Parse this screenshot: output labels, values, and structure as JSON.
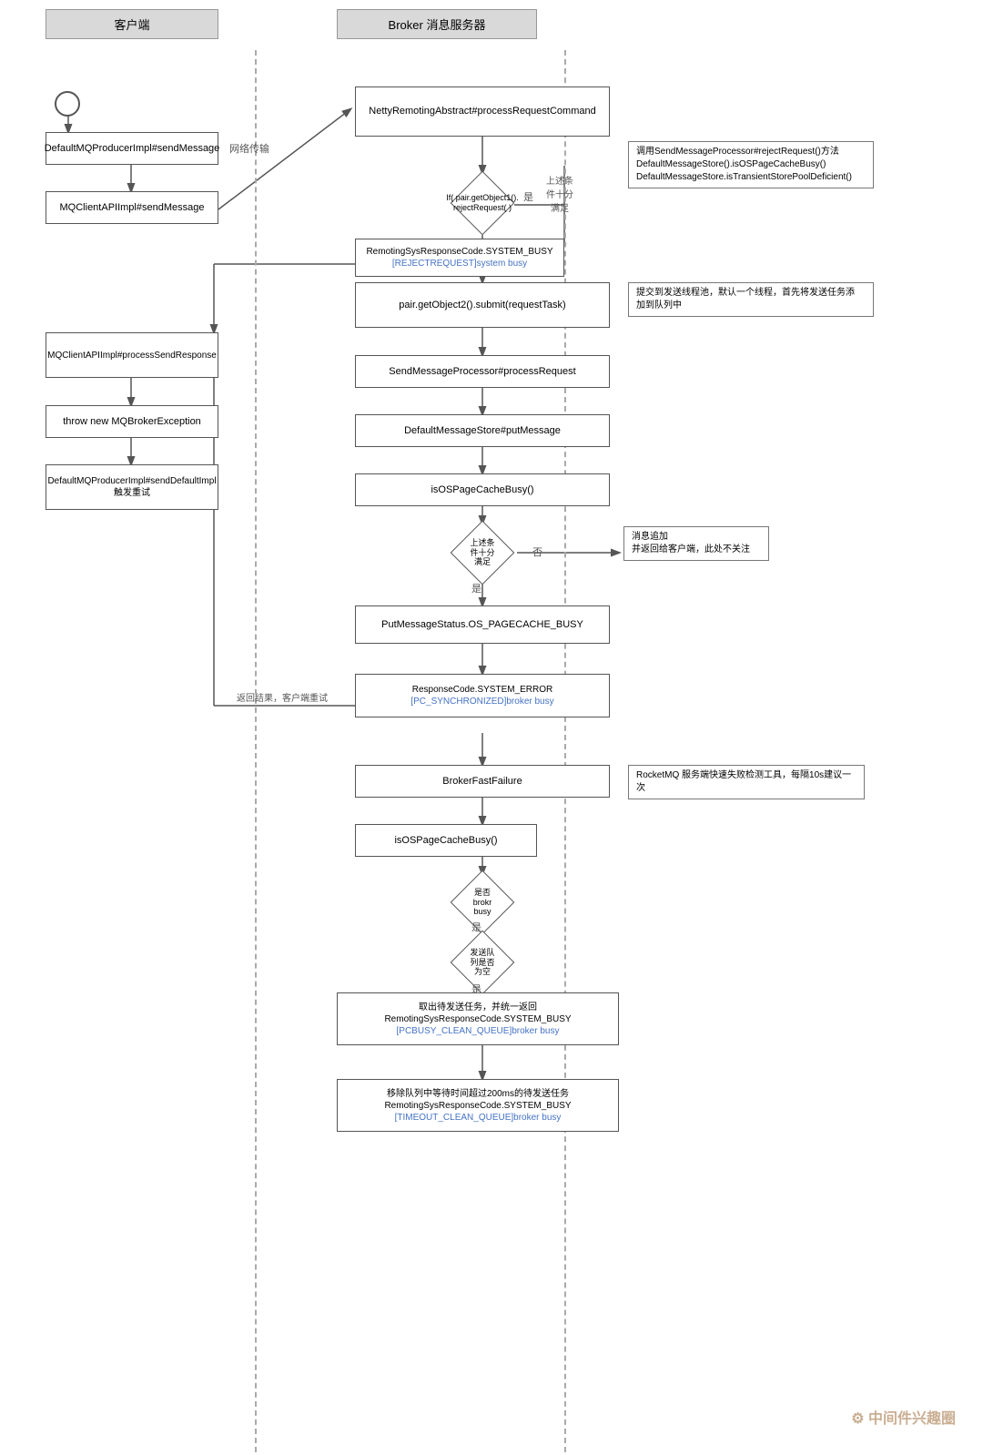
{
  "headers": {
    "client": "客户端",
    "broker": "Broker 消息服务器"
  },
  "nodes": {
    "start": {
      "label": ""
    },
    "n1": {
      "label": "DefaultMQProducerImpl#sendMessage"
    },
    "n2": {
      "label": "MQClientAPIImpl#sendMessage"
    },
    "n3": {
      "label": "NettyRemotingAbstract#processRequestCommand"
    },
    "n4_condition": {
      "label": "If( pair.getObject1().rejectRequest( )"
    },
    "n4_annotation": {
      "label": "调用SendMessageProcessor#rejectRequest()方法\nDefaultMessageStore().isOSPageCacheBusy()\nDefaultMessageStore.isTransientStorePoolDeficient()"
    },
    "n5": {
      "label": "RemotingSysResponseCode.SYSTEM_BUSY\n[REJECTREQUEST]system busy",
      "blue": "[REJECTREQUEST]system busy"
    },
    "n5_diamond_label": {
      "label": "上述条\n件十分\n满足"
    },
    "n6_annotation": {
      "label": "提交到发送线程池，默认一个线程，首先将发送任务添\n加到队列中"
    },
    "n6": {
      "label": "pair.getObject2().submit(requestTask)"
    },
    "n7": {
      "label": "SendMessageProcessor#processRequest"
    },
    "n8": {
      "label": "DefaultMessageStore#putMessage"
    },
    "n9": {
      "label": "isOSPageCacheBusy()"
    },
    "n10_diamond_label": {
      "label": "上述条\n件十分\n满足"
    },
    "n10_no_annotation": {
      "label": "消息追加\n并返回给客户端，此处不关注"
    },
    "n11": {
      "label": "PutMessageStatus.OS_PAGECACHE_BUSY"
    },
    "n12_annotation": {
      "label": "返回结果，客户端重试"
    },
    "n12": {
      "label": "ResponseCode.SYSTEM_ERROR\n[PC_SYNCHRONIZED]broker busy",
      "blue": "[PC_SYNCHRONIZED]broker busy"
    },
    "n13": {
      "label": "BrokerFastFailure"
    },
    "n13_annotation": {
      "label": "RocketMQ 服务端快速失败检测工具，每隔10s建议一次"
    },
    "n14": {
      "label": "isOSPageCacheBusy()"
    },
    "n14_diamond_label": {
      "label": "是否\nbrokr\nbusy"
    },
    "n15_diamond_label": {
      "label": "发送队\n列是否\n为空"
    },
    "n16": {
      "label": "取出待发送任务，并统一返回\nRemotingSysResponseCode.SYSTEM_BUSY\n[PCBUSY_CLEAN_QUEUE]broker busy",
      "blue": "[PCBUSY_CLEAN_QUEUE]broker busy"
    },
    "n17": {
      "label": "移除队列中等待时间超过200ms的待发送任务\nRemotingSysResponseCode.SYSTEM_BUSY\n[TIMEOUT_CLEAN_QUEUE]broker busy",
      "blue": "[TIMEOUT_CLEAN_QUEUE]broker busy"
    },
    "n_processSend": {
      "label": "MQClientAPIImpl#processSendResponse"
    },
    "n_throw": {
      "label": "throw new MQBrokerException"
    },
    "n_retry": {
      "label": "DefaultMQProducerImpl#sendDefaultImpl\n触发重试"
    },
    "labels": {
      "network": "网络传输",
      "yes1": "是",
      "yes2": "是",
      "no1": "否"
    }
  }
}
